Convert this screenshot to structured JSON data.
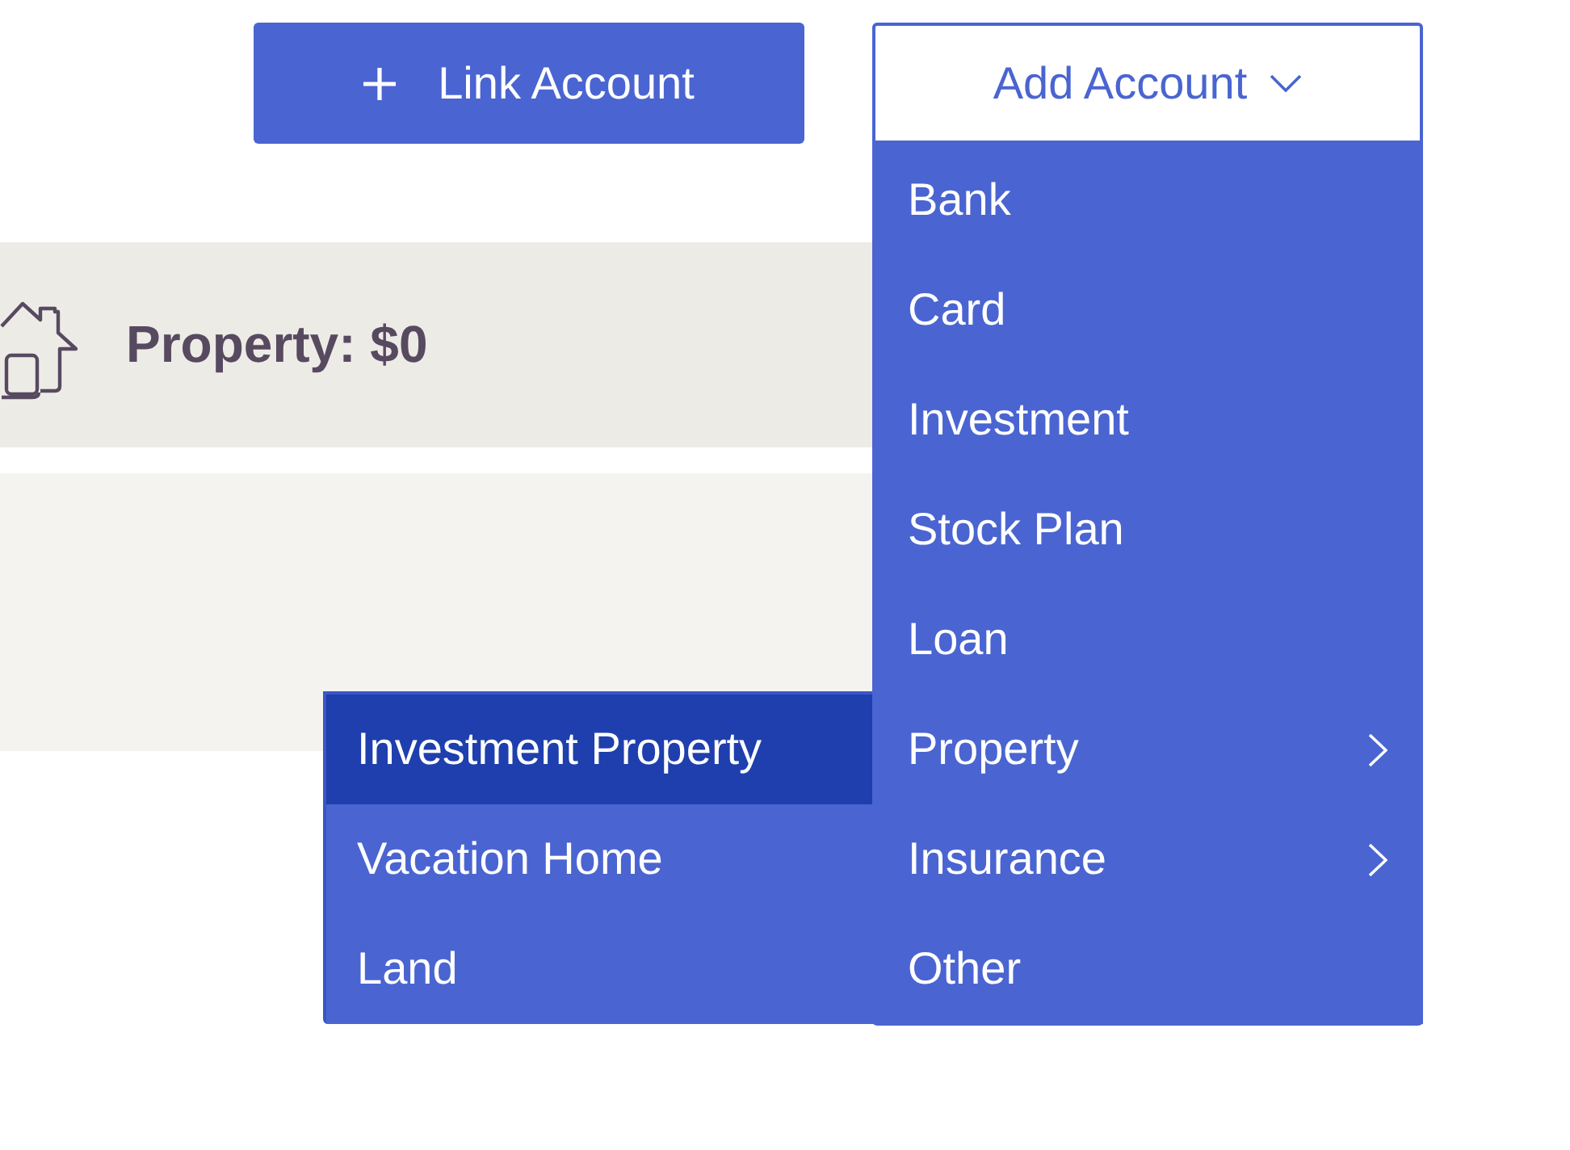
{
  "toolbar": {
    "link_account": {
      "label": "Link Account"
    },
    "add_account": {
      "label": "Add Account",
      "expanded": true
    }
  },
  "add_account_menu": {
    "items": [
      {
        "label": "Bank",
        "kind": "item",
        "selected": false
      },
      {
        "label": "Card",
        "kind": "item",
        "selected": false
      },
      {
        "label": "Investment",
        "kind": "item",
        "selected": false
      },
      {
        "label": "Stock Plan",
        "kind": "item",
        "selected": false
      },
      {
        "label": "Loan",
        "kind": "item",
        "selected": false
      },
      {
        "label": "Property",
        "kind": "submenu",
        "selected": false,
        "expanded": true,
        "children": [
          {
            "label": "Investment Property",
            "selected": true
          },
          {
            "label": "Vacation Home",
            "selected": false
          },
          {
            "label": "Land",
            "selected": false
          }
        ]
      },
      {
        "label": "Insurance",
        "kind": "submenu",
        "selected": false,
        "expanded": false
      },
      {
        "label": "Other",
        "kind": "item",
        "selected": false
      }
    ]
  },
  "property_summary": {
    "title": "Property: $0"
  }
}
